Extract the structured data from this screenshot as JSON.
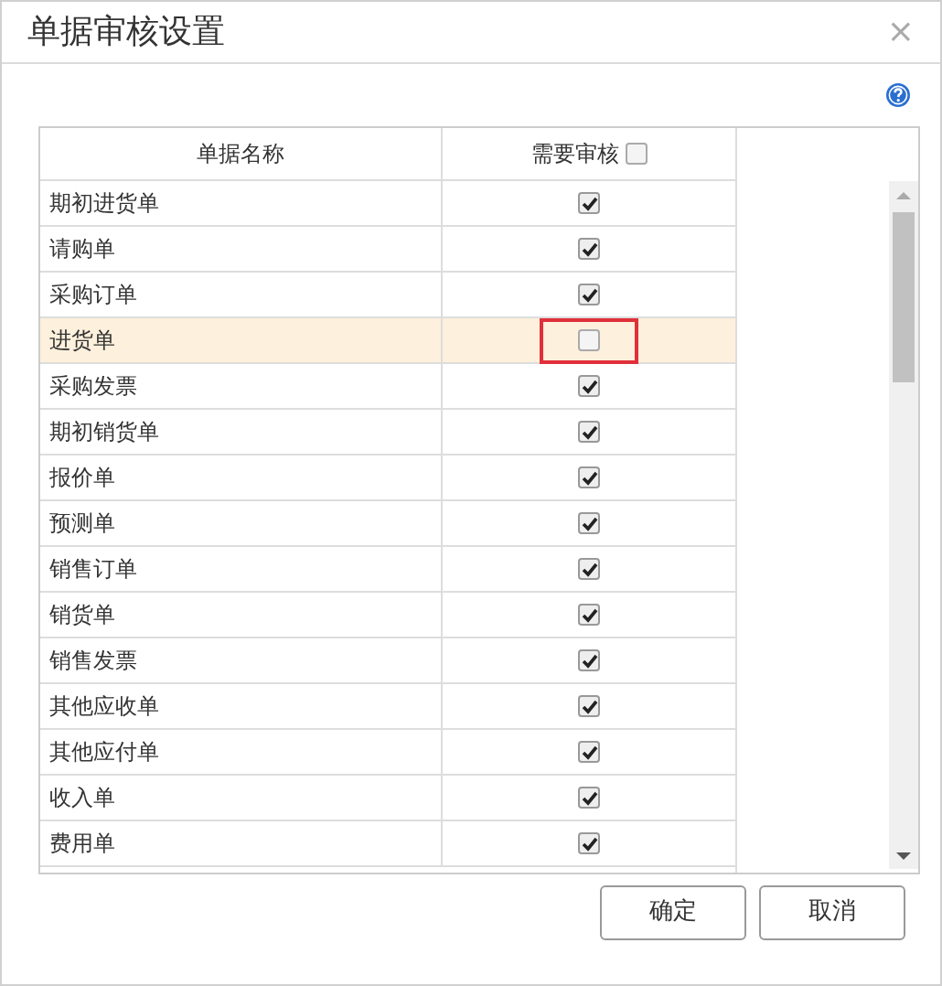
{
  "window": {
    "title": "单据审核设置",
    "close": "×"
  },
  "table": {
    "columns": [
      {
        "label": "单据名称"
      },
      {
        "label": "需要审核",
        "checked": false
      }
    ],
    "rows": [
      {
        "name": "期初进货单",
        "checked": true,
        "selected": false,
        "highlighted": false
      },
      {
        "name": "请购单",
        "checked": true,
        "selected": false,
        "highlighted": false
      },
      {
        "name": "采购订单",
        "checked": true,
        "selected": false,
        "highlighted": false
      },
      {
        "name": "进货单",
        "checked": false,
        "selected": true,
        "highlighted": true
      },
      {
        "name": "采购发票",
        "checked": true,
        "selected": false,
        "highlighted": false
      },
      {
        "name": "期初销货单",
        "checked": true,
        "selected": false,
        "highlighted": false
      },
      {
        "name": "报价单",
        "checked": true,
        "selected": false,
        "highlighted": false
      },
      {
        "name": "预测单",
        "checked": true,
        "selected": false,
        "highlighted": false
      },
      {
        "name": "销售订单",
        "checked": true,
        "selected": false,
        "highlighted": false
      },
      {
        "name": "销货单",
        "checked": true,
        "selected": false,
        "highlighted": false
      },
      {
        "name": "销售发票",
        "checked": true,
        "selected": false,
        "highlighted": false
      },
      {
        "name": "其他应收单",
        "checked": true,
        "selected": false,
        "highlighted": false
      },
      {
        "name": "其他应付单",
        "checked": true,
        "selected": false,
        "highlighted": false
      },
      {
        "name": "收入单",
        "checked": true,
        "selected": false,
        "highlighted": false
      },
      {
        "name": "费用单",
        "checked": true,
        "selected": false,
        "highlighted": false
      }
    ]
  },
  "buttons": [
    {
      "label": "确定"
    },
    {
      "label": "取消"
    }
  ]
}
